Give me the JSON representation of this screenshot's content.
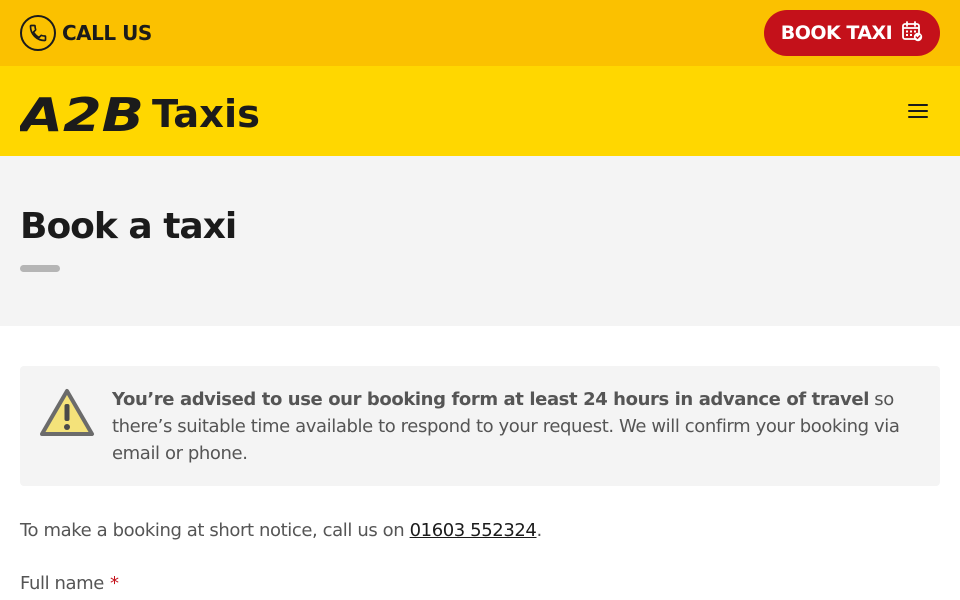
{
  "topbar": {
    "call_label": "CALL US",
    "book_label": "BOOK TAXI"
  },
  "header": {
    "logo_mark": "A2B",
    "logo_word": "Taxis"
  },
  "hero": {
    "title": "Book a taxi"
  },
  "notice": {
    "bold_text": "You’re advised to use our booking form at least 24 hours in advance of travel",
    "rest_text": " so there’s suitable time available to respond to your request. We will confirm your booking via email or phone."
  },
  "short_notice": {
    "prefix": "To make a booking at short notice, call us on ",
    "phone": "01603 552324",
    "suffix": "."
  },
  "form": {
    "full_name_label": "Full name",
    "required_mark": "*"
  },
  "colors": {
    "topbar": "#fbc100",
    "header": "#ffd700",
    "book_button": "#c4111a",
    "hero_bg": "#f4f4f4"
  },
  "icons": {
    "phone": "phone-icon",
    "calendar": "calendar-check-icon",
    "menu": "hamburger-menu-icon",
    "warning": "warning-triangle-icon"
  }
}
